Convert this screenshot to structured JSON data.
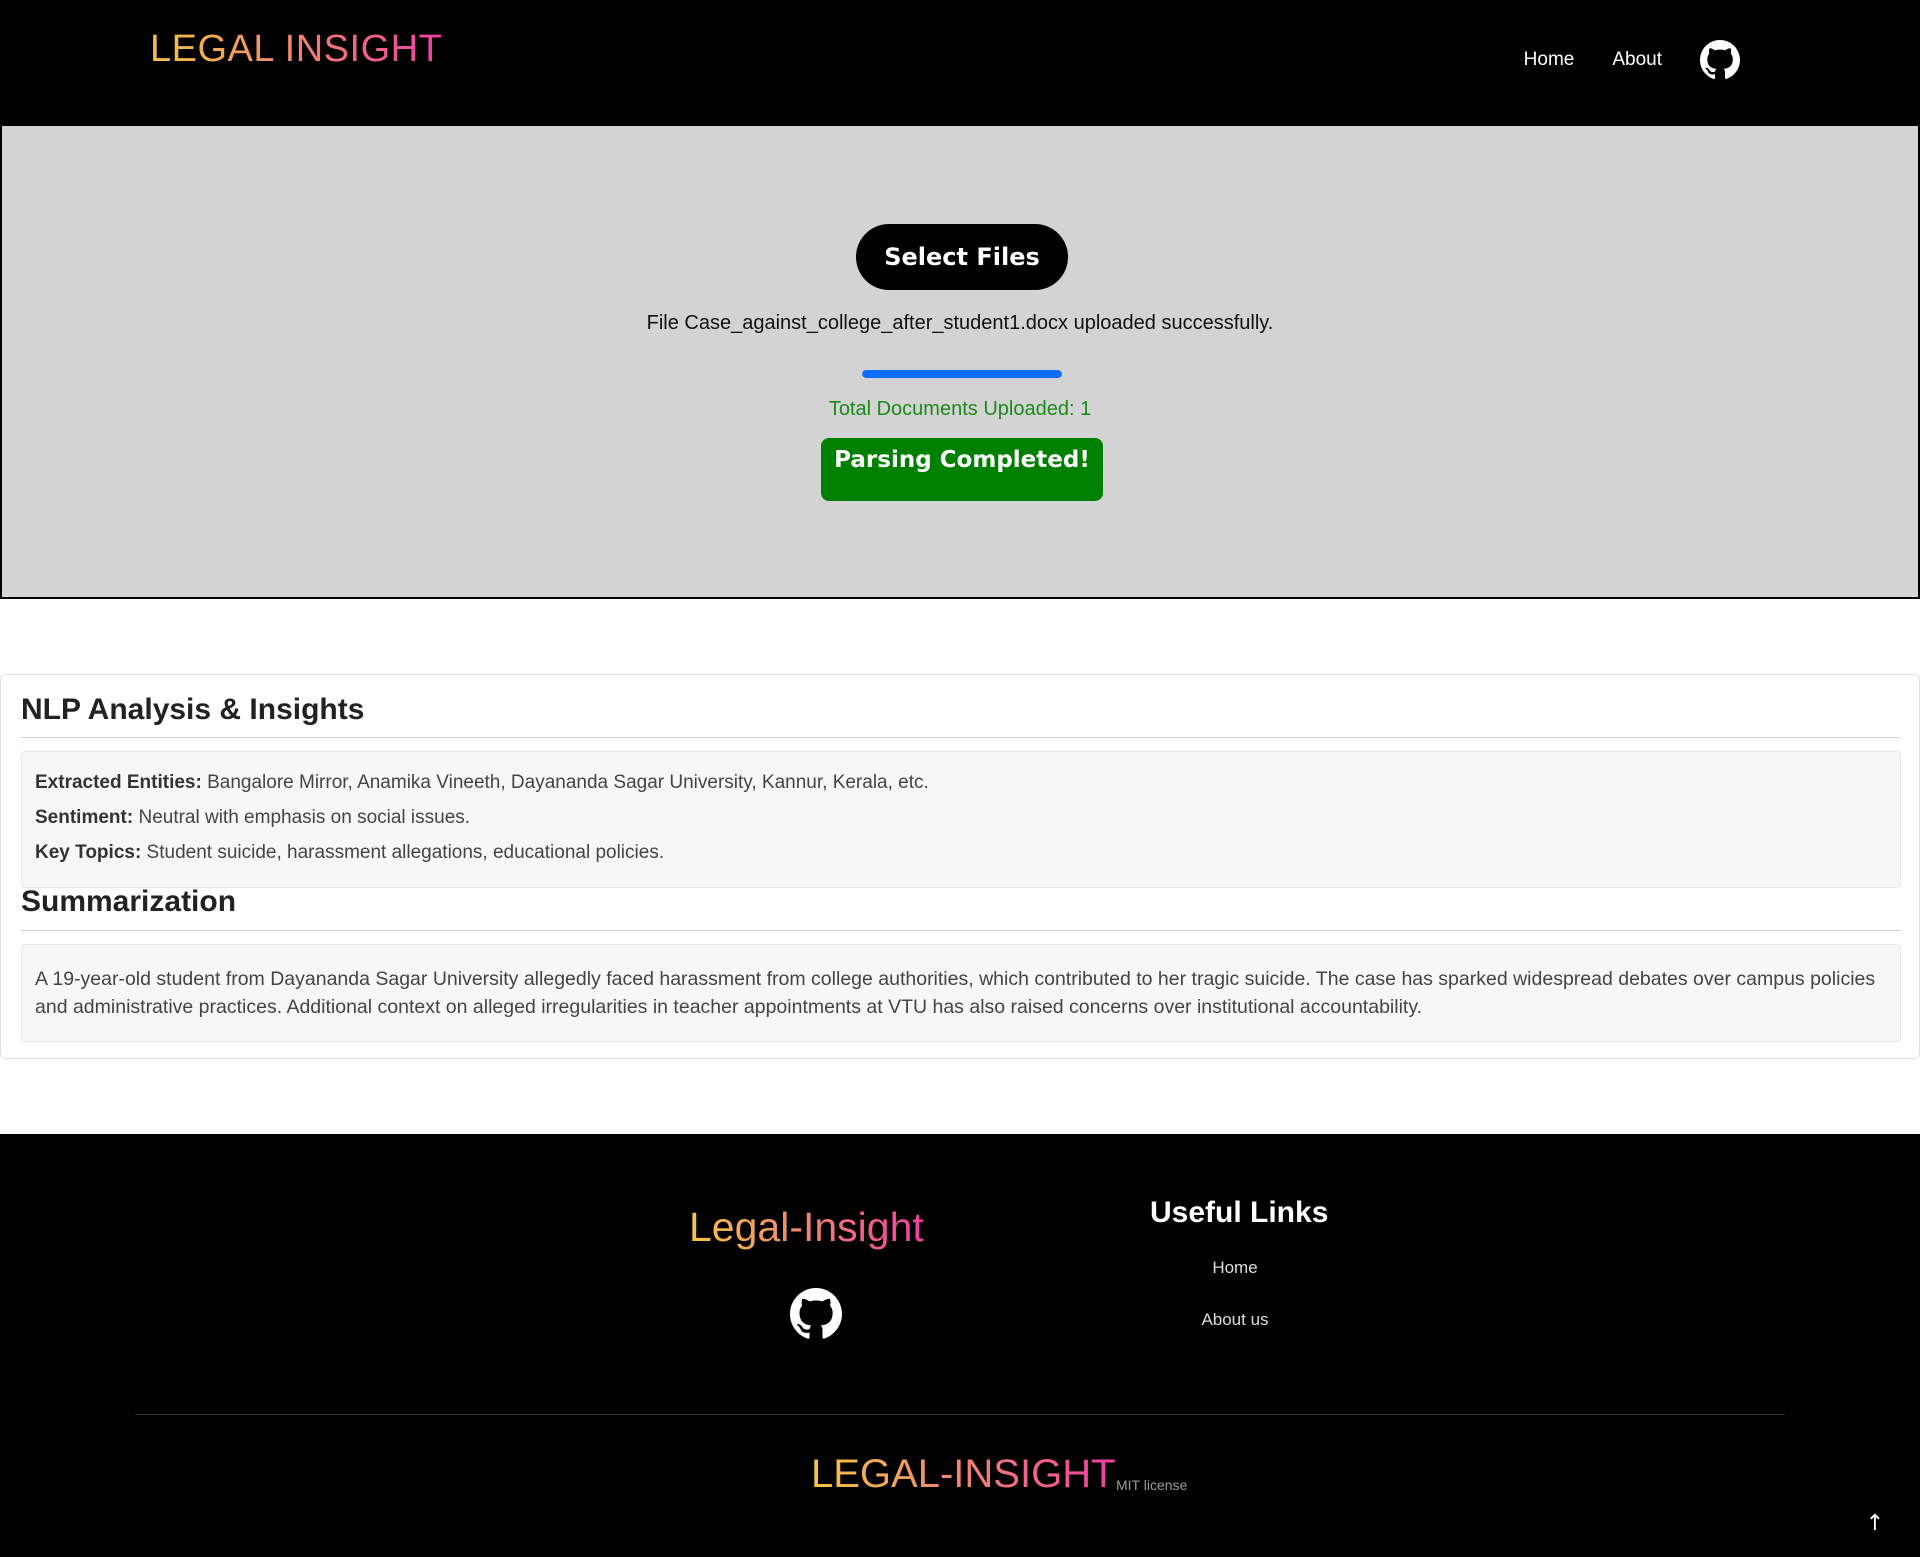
{
  "header": {
    "brand": "LEGAL INSIGHT",
    "nav": [
      {
        "label": "Home"
      },
      {
        "label": "About"
      }
    ],
    "github_icon": "github-icon"
  },
  "upload": {
    "select_label": "Select Files",
    "message": "File Case_against_college_after_student1.docx uploaded successfully.",
    "progress_fraction": 1.0,
    "total_docs": "Total Documents Uploaded: 1",
    "status_label": "Parsing Completed!"
  },
  "analysis": {
    "title": "NLP Analysis & Insights",
    "entities_label": "Extracted Entities:",
    "entities_value": " Bangalore Mirror, Anamika Vineeth, Dayananda Sagar University, Kannur, Kerala, etc.",
    "sentiment_label": "Sentiment:",
    "sentiment_value": " Neutral with emphasis on social issues.",
    "topics_label": "Key Topics:",
    "topics_value": " Student suicide, harassment allegations, educational policies."
  },
  "summarization": {
    "title": "Summarization",
    "text": "A 19-year-old student from Dayananda Sagar University allegedly faced harassment from college authorities, which contributed to her tragic suicide. The case has sparked widespread debates over campus policies and administrative practices. Additional context on alleged irregularities in teacher appointments at VTU has also raised concerns over institutional accountability."
  },
  "footer": {
    "brand": "Legal-Insight",
    "links_title": "Useful Links",
    "links": [
      {
        "label": "Home"
      },
      {
        "label": "About us"
      }
    ],
    "bottom_brand": "LEGAL-INSIGHT",
    "license": "MIT license",
    "to_top_icon": "arrow-up-icon"
  },
  "colors": {
    "accent_blue": "#0d6efd",
    "success_green": "#008000",
    "gradient_start": "#f5c542",
    "gradient_end": "#ee3fa6"
  }
}
